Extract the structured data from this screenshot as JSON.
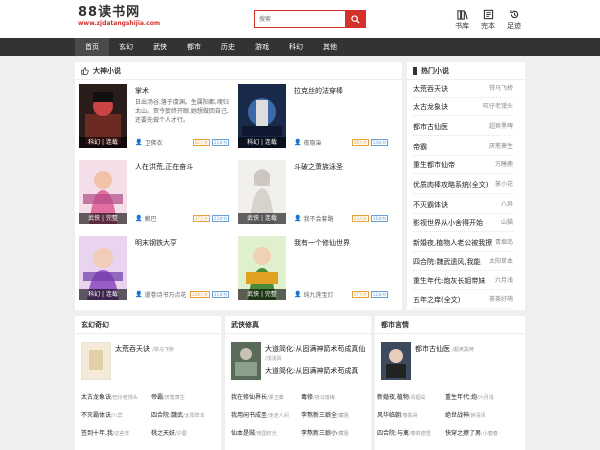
{
  "header": {
    "logo_name": "88读书网",
    "logo_domain": "www.zjdatangshijia.com",
    "search_placeholder": "搜索",
    "icons": [
      {
        "icon": "bookshelf-icon",
        "label": "书库"
      },
      {
        "icon": "finished-icon",
        "label": "完本"
      },
      {
        "icon": "history-icon",
        "label": "足迹"
      }
    ]
  },
  "nav": [
    "首页",
    "玄幻",
    "武侠",
    "都市",
    "历史",
    "游戏",
    "科幻",
    "其他"
  ],
  "featured": {
    "title": "大神小说",
    "books": [
      {
        "title": "掌术",
        "desc": "日出汤谷,落于虞渊。生属阳都,魂归太山。贺今妾终开眼,她想做回自己,还要先做个人才行。",
        "author": "卫佛衣",
        "tag": "科幻 | 连载",
        "b1": "62万字",
        "b2": "21本书"
      },
      {
        "title": "拉克丝的法穿棒",
        "desc": "",
        "author": "夜隐枭",
        "tag": "科幻 | 连载",
        "b1": "28万字",
        "b2": "54本书"
      },
      {
        "title": "人在洪荒,正在奋斗",
        "desc": "",
        "author": "赖巴",
        "tag": "武侠 | 完整",
        "b1": "37万字",
        "b2": "22本书"
      },
      {
        "title": "斗破之萧族泳圣",
        "desc": "",
        "author": "我不会套路",
        "tag": "武侠 | 连载",
        "b1": "33万字",
        "b2": "26本书"
      },
      {
        "title": "明末钢铁大亨",
        "desc": "",
        "author": "漫卷诗书万点花",
        "tag": "科幻 | 连载",
        "b1": "248万字",
        "b2": "31本书"
      },
      {
        "title": "我有一个修仙世界",
        "desc": "",
        "author": "纯九莲宝灯",
        "tag": "武侠 | 完整",
        "b1": "37万字",
        "b2": "12本书"
      }
    ]
  },
  "hot": {
    "title": "热门小说",
    "items": [
      {
        "name": "太荒吞天诀",
        "author": "铁马飞桥"
      },
      {
        "name": "太古龙象诀",
        "author": "旺仔老馒头"
      },
      {
        "name": "都市古仙医",
        "author": "超爽黑啤"
      },
      {
        "name": "帝霸",
        "author": "厌笔萧生"
      },
      {
        "name": "重生都市仙帝",
        "author": "万睡鹿"
      },
      {
        "name": "优质肉棒攻略系统(全文)",
        "author": "掌小花"
      },
      {
        "name": "不灭霸体诀",
        "author": "八异"
      },
      {
        "name": "影视世界从小舍得开始",
        "author": "山猫"
      },
      {
        "name": "新婚夜,植物人老公被我撩",
        "author": "青烟岛"
      },
      {
        "name": "四合院:魏武遗风,我能",
        "author": "太阳草本"
      },
      {
        "name": "重生年代:炮灰长姐带妹",
        "author": "六月浅"
      },
      {
        "name": "五年之痒(全文)",
        "author": "茶茶好萌"
      }
    ]
  },
  "columns": [
    {
      "title": "玄幻奇幻",
      "feat": {
        "name": "太荒吞天诀",
        "author": "/铁马飞桥"
      },
      "rows": [
        {
          "a": "太古龙象诀",
          "as": "/旺仔老馒头",
          "b": "帝霸",
          "bs": "/厌笔萧生"
        },
        {
          "a": "不灭霸体诀",
          "as": "/八异",
          "b": "四合院:魏武",
          "bs": "/太阳草本"
        },
        {
          "a": "签到十年,我",
          "as": "/这些年",
          "b": "桃之天妖",
          "bs": "/沪蓉"
        }
      ]
    },
    {
      "title": "武侠修真",
      "feat": {
        "name": "大道简化:从固满神箭术苟成真仙",
        "author": "/浅浅风",
        "name2": "大道简化:从固满神箭术苟成真"
      },
      "rows": [
        {
          "a": "我在修仙界长",
          "as": "/柔卫秦",
          "b": "毒修",
          "bs": "/夜马落梅"
        },
        {
          "a": "我用闲书成圣",
          "as": "/走走人间",
          "b": "李熬新三娘全",
          "bs": "/藏阻"
        },
        {
          "a": "仙本是贼",
          "as": "/南国时光",
          "b": "李熬新三娘小",
          "bs": "/藏阻"
        }
      ]
    },
    {
      "title": "都市言情",
      "feat": {
        "name": "都市古仙医",
        "author": "/超爽黑啤"
      },
      "rows": [
        {
          "a": "新婚夜,植物",
          "as": "/青烟岛",
          "b": "重生年代:炮",
          "bs": "/六月浅"
        },
        {
          "a": "风华临朝",
          "as": "/春陈哥",
          "b": "绝世战神",
          "bs": "/醉清风"
        },
        {
          "a": "四合院:与禽",
          "as": "/泰莉德雪",
          "b": "快穿之撩了男",
          "bs": "/小春春"
        }
      ]
    }
  ]
}
